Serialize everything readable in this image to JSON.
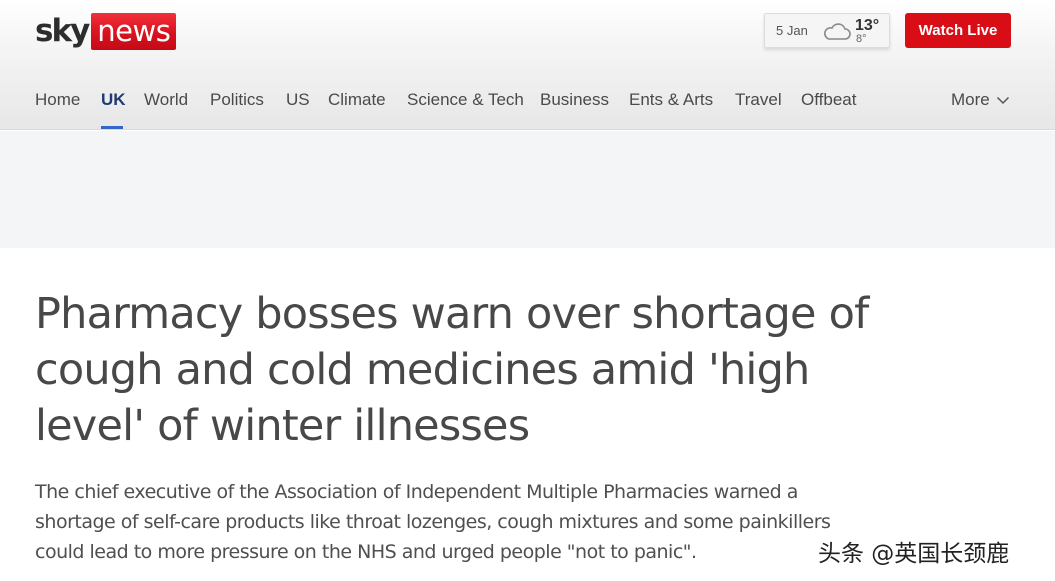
{
  "brand": {
    "sky": "sky",
    "news": "news"
  },
  "weather": {
    "date": "5 Jan",
    "icon": "cloud-icon",
    "high": "13°",
    "low": "8°"
  },
  "watch_live_label": "Watch Live",
  "nav": {
    "items": [
      {
        "label": "Home"
      },
      {
        "label": "UK",
        "active": true
      },
      {
        "label": "World"
      },
      {
        "label": "Politics"
      },
      {
        "label": "US"
      },
      {
        "label": "Climate"
      },
      {
        "label": "Science & Tech"
      },
      {
        "label": "Business"
      },
      {
        "label": "Ents & Arts"
      },
      {
        "label": "Travel"
      },
      {
        "label": "Offbeat"
      }
    ],
    "more_label": "More"
  },
  "article": {
    "headline": "Pharmacy bosses warn over shortage of cough and cold medicines amid 'high level' of winter illnesses",
    "standfirst": "The chief executive of the Association of Independent Multiple Pharmacies warned a shortage of self-care products like throat lozenges, cough mixtures and some painkillers could lead to more pressure on the NHS and urged people \"not to panic\"."
  },
  "watermark": "头条 @英国长颈鹿",
  "colors": {
    "brand_red": "#d80d16",
    "active_nav": "#1f3b73",
    "active_underline": "#3366cc"
  }
}
